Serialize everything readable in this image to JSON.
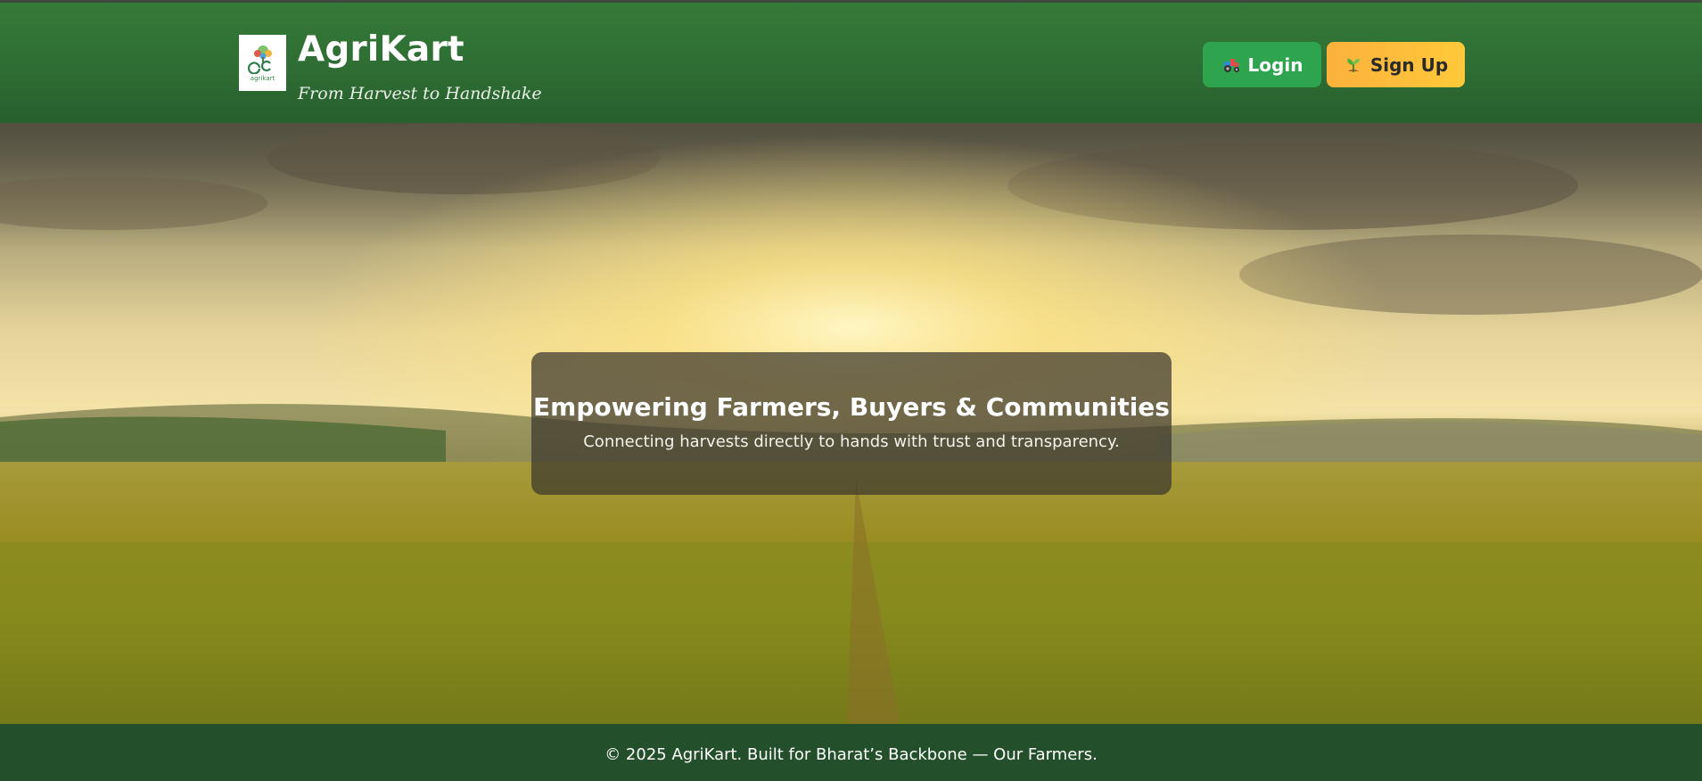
{
  "brand": {
    "name": "AgriKart",
    "tagline": "From Harvest to Handshake",
    "logo_text": "agrikart",
    "logo_icon": "tree-logo-icon"
  },
  "header": {
    "login_label": "Login",
    "login_icon": "tractor-icon",
    "signup_label": "Sign Up",
    "signup_icon": "seedling-icon"
  },
  "hero": {
    "title": "Empowering Farmers, Buyers & Communities",
    "subtitle": "Connecting harvests directly to hands with trust and transparency.",
    "background": "sunrise-over-cornfield"
  },
  "footer": {
    "text": "© 2025 AgriKart. Built for Bharat’s Backbone — Our Farmers."
  },
  "colors": {
    "header_green": "#2e6d33",
    "login_green": "#2ea44f",
    "signup_yellow": "#ffc93a",
    "footer_green": "#234f2a"
  }
}
